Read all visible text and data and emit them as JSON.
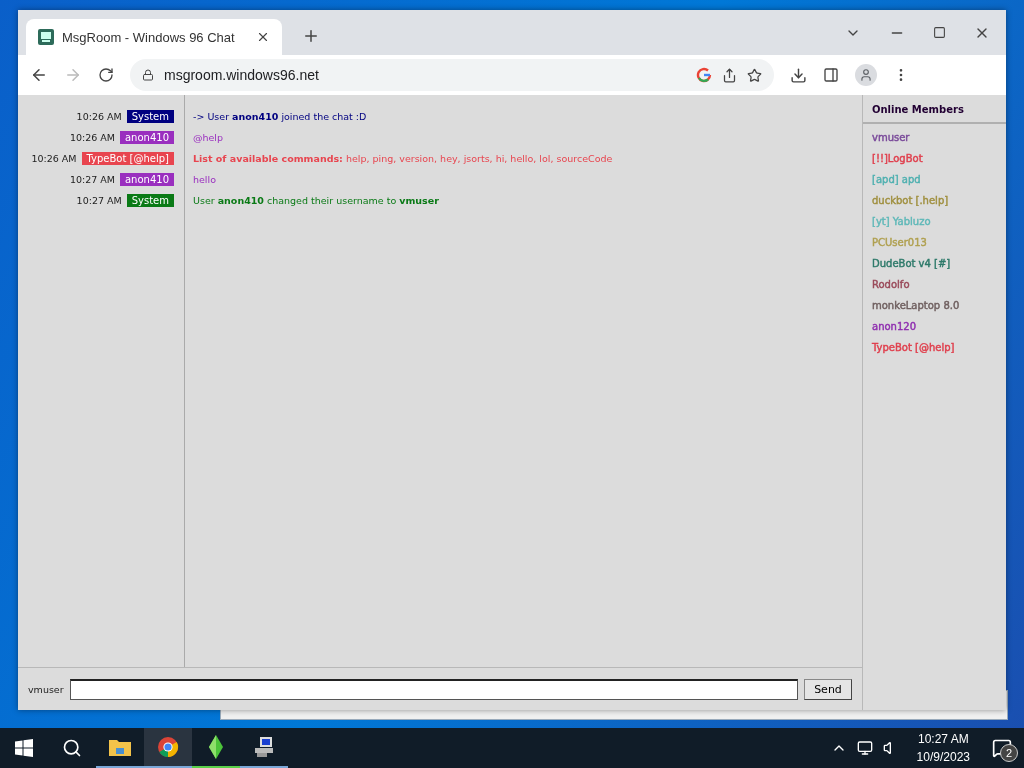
{
  "browser": {
    "tab_title": "MsgRoom - Windows 96 Chat",
    "url": "msgroom.windows96.net"
  },
  "chat": {
    "messages": [
      {
        "time": "10:26 AM",
        "user": "System",
        "color": "#000080",
        "text": "-> User **anon410** joined the chat :D"
      },
      {
        "time": "10:26 AM",
        "user": "anon410",
        "color": "#9a2fbf",
        "text": "@help"
      },
      {
        "time": "10:26 AM",
        "user": "TypeBot [@help]",
        "color": "#e8454f",
        "text": "**List of available commands:** help, ping, version, hey, jsorts, hi, hello, lol, sourceCode"
      },
      {
        "time": "10:27 AM",
        "user": "anon410",
        "color": "#9a2fbf",
        "text": "hello"
      },
      {
        "time": "10:27 AM",
        "user": "System",
        "color": "#0a7a16",
        "text": "User **anon410** changed their username to **vmuser**"
      }
    ]
  },
  "members": {
    "title": "Online Members",
    "items": [
      {
        "name": "vmuser",
        "color": "#7a4a9a"
      },
      {
        "name": "[!!]LogBot",
        "color": "#e0404e"
      },
      {
        "name": "[apd] apd",
        "color": "#4fb0b0"
      },
      {
        "name": "duckbot [.help]",
        "color": "#a09040"
      },
      {
        "name": "[yt] Yabluzo",
        "color": "#5fb8b8"
      },
      {
        "name": "PCUser013",
        "color": "#b0a050"
      },
      {
        "name": "DudeBot v4 [#]",
        "color": "#2e7a6a"
      },
      {
        "name": "Rodolfo",
        "color": "#9a4a5a"
      },
      {
        "name": "monkeLaptop 8.0",
        "color": "#706060"
      },
      {
        "name": "anon120",
        "color": "#9030b0"
      },
      {
        "name": "TypeBot [@help]",
        "color": "#e0404e"
      }
    ]
  },
  "composer": {
    "username": "vmuser",
    "send": "Send"
  },
  "taskbar": {
    "time": "10:27 AM",
    "date": "10/9/2023",
    "notifications": "2"
  }
}
